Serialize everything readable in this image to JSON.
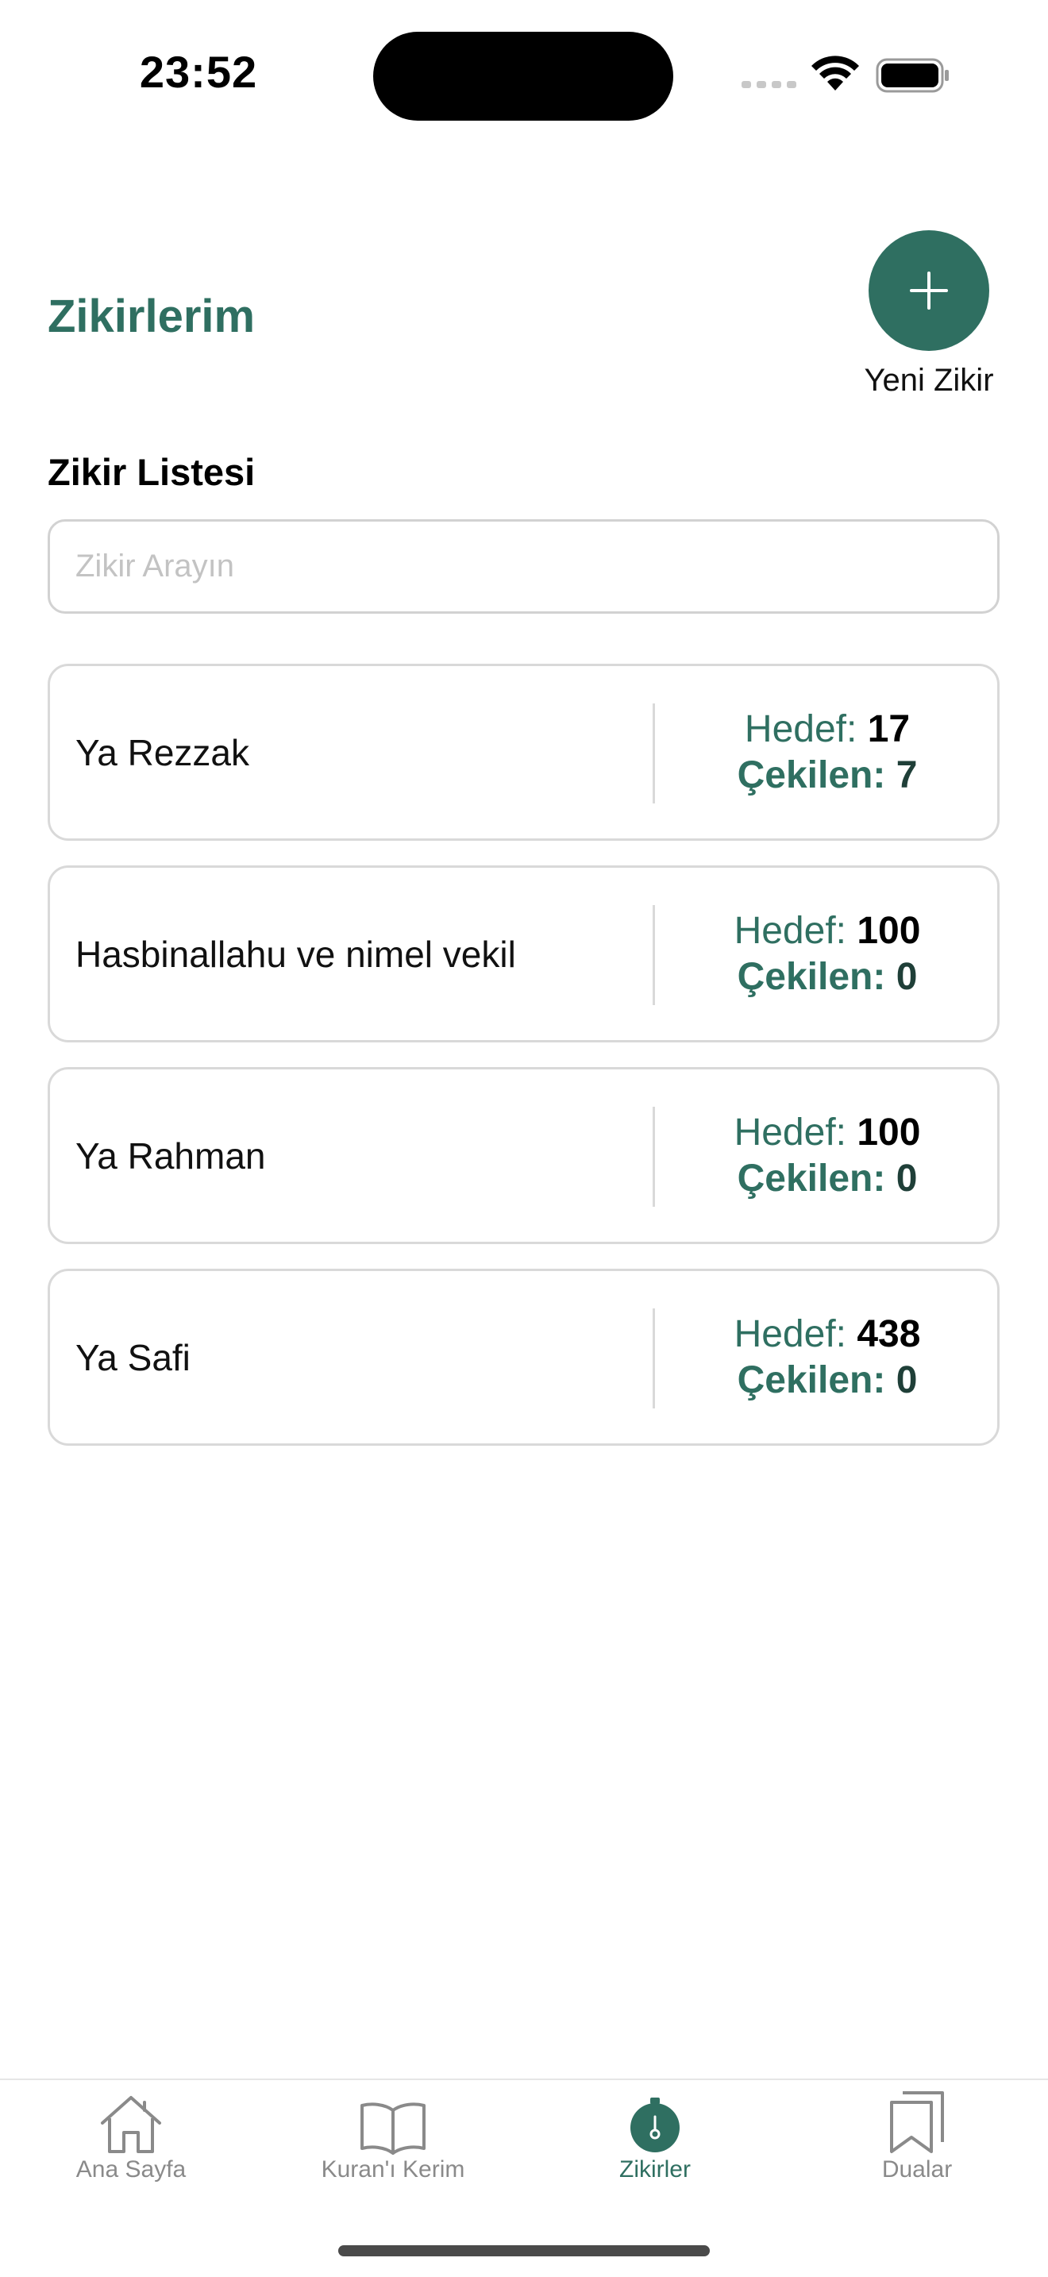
{
  "status_bar": {
    "time": "23:52"
  },
  "header": {
    "title": "Zikirlerim",
    "add_button_label": "Yeni Zikir"
  },
  "list": {
    "section_title": "Zikir Listesi",
    "search_placeholder": "Zikir Arayın",
    "target_label": "Hedef:",
    "count_label": "Çekilen:",
    "items": [
      {
        "name": "Ya Rezzak",
        "target": "17",
        "count": "7"
      },
      {
        "name": "Hasbinallahu ve nimel vekil",
        "target": "100",
        "count": "0"
      },
      {
        "name": "Ya Rahman",
        "target": "100",
        "count": "0"
      },
      {
        "name": "Ya Safi",
        "target": "438",
        "count": "0"
      }
    ]
  },
  "tab_bar": {
    "tabs": [
      {
        "label": "Ana Sayfa",
        "icon": "home-icon",
        "active": false
      },
      {
        "label": "Kuran'ı Kerim",
        "icon": "book-icon",
        "active": false
      },
      {
        "label": "Zikirler",
        "icon": "counter-icon",
        "active": true
      },
      {
        "label": "Dualar",
        "icon": "bookmarks-icon",
        "active": false
      }
    ]
  },
  "colors": {
    "accent": "#2f6f61",
    "inactive_tab": "#8a8a8a",
    "border": "#d9d9d9"
  }
}
